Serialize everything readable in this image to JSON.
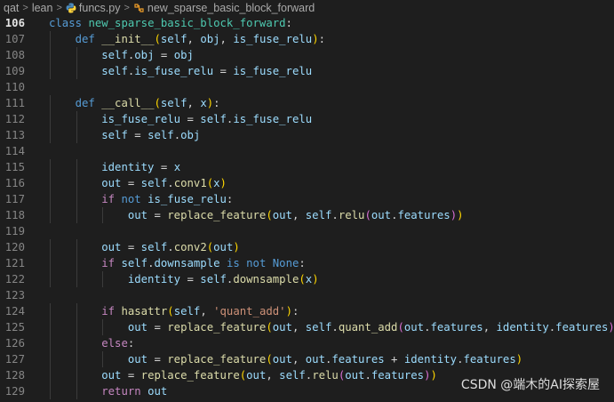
{
  "breadcrumb": {
    "items": [
      "qat",
      "lean",
      "funcs.py",
      "new_sparse_basic_block_forward"
    ],
    "separator": ">"
  },
  "editor": {
    "active_line": 106,
    "lines": [
      {
        "n": 106,
        "tokens": [
          {
            "t": "class",
            "c": "kw"
          },
          {
            "t": " "
          },
          {
            "t": "new_sparse_basic_block_forward",
            "c": "cls"
          },
          {
            "t": ":"
          }
        ]
      },
      {
        "n": 107,
        "tokens": [
          {
            "t": "    "
          },
          {
            "t": "def",
            "c": "kw"
          },
          {
            "t": " "
          },
          {
            "t": "__init__",
            "c": "fn"
          },
          {
            "t": "(",
            "c": "p1"
          },
          {
            "t": "self",
            "c": "self"
          },
          {
            "t": ", "
          },
          {
            "t": "obj",
            "c": "var"
          },
          {
            "t": ", "
          },
          {
            "t": "is_fuse_relu",
            "c": "var"
          },
          {
            "t": ")",
            "c": "p1"
          },
          {
            "t": ":"
          }
        ]
      },
      {
        "n": 108,
        "tokens": [
          {
            "t": "        "
          },
          {
            "t": "self",
            "c": "self"
          },
          {
            "t": "."
          },
          {
            "t": "obj",
            "c": "var"
          },
          {
            "t": " = "
          },
          {
            "t": "obj",
            "c": "var"
          }
        ]
      },
      {
        "n": 109,
        "tokens": [
          {
            "t": "        "
          },
          {
            "t": "self",
            "c": "self"
          },
          {
            "t": "."
          },
          {
            "t": "is_fuse_relu",
            "c": "var"
          },
          {
            "t": " = "
          },
          {
            "t": "is_fuse_relu",
            "c": "var"
          }
        ]
      },
      {
        "n": 110,
        "tokens": []
      },
      {
        "n": 111,
        "tokens": [
          {
            "t": "    "
          },
          {
            "t": "def",
            "c": "kw"
          },
          {
            "t": " "
          },
          {
            "t": "__call__",
            "c": "fn"
          },
          {
            "t": "(",
            "c": "p1"
          },
          {
            "t": "self",
            "c": "self"
          },
          {
            "t": ", "
          },
          {
            "t": "x",
            "c": "var"
          },
          {
            "t": ")",
            "c": "p1"
          },
          {
            "t": ":"
          }
        ]
      },
      {
        "n": 112,
        "tokens": [
          {
            "t": "        "
          },
          {
            "t": "is_fuse_relu",
            "c": "var"
          },
          {
            "t": " = "
          },
          {
            "t": "self",
            "c": "self"
          },
          {
            "t": "."
          },
          {
            "t": "is_fuse_relu",
            "c": "var"
          }
        ]
      },
      {
        "n": 113,
        "tokens": [
          {
            "t": "        "
          },
          {
            "t": "self",
            "c": "self"
          },
          {
            "t": " = "
          },
          {
            "t": "self",
            "c": "self"
          },
          {
            "t": "."
          },
          {
            "t": "obj",
            "c": "var"
          }
        ]
      },
      {
        "n": 114,
        "tokens": []
      },
      {
        "n": 115,
        "tokens": [
          {
            "t": "        "
          },
          {
            "t": "identity",
            "c": "var"
          },
          {
            "t": " = "
          },
          {
            "t": "x",
            "c": "var"
          }
        ]
      },
      {
        "n": 116,
        "tokens": [
          {
            "t": "        "
          },
          {
            "t": "out",
            "c": "var"
          },
          {
            "t": " = "
          },
          {
            "t": "self",
            "c": "self"
          },
          {
            "t": "."
          },
          {
            "t": "conv1",
            "c": "fn"
          },
          {
            "t": "(",
            "c": "p1"
          },
          {
            "t": "x",
            "c": "var"
          },
          {
            "t": ")",
            "c": "p1"
          }
        ]
      },
      {
        "n": 117,
        "tokens": [
          {
            "t": "        "
          },
          {
            "t": "if",
            "c": "kwc"
          },
          {
            "t": " "
          },
          {
            "t": "not",
            "c": "kw"
          },
          {
            "t": " "
          },
          {
            "t": "is_fuse_relu",
            "c": "var"
          },
          {
            "t": ":"
          }
        ]
      },
      {
        "n": 118,
        "tokens": [
          {
            "t": "            "
          },
          {
            "t": "out",
            "c": "var"
          },
          {
            "t": " = "
          },
          {
            "t": "replace_feature",
            "c": "fn"
          },
          {
            "t": "(",
            "c": "p1"
          },
          {
            "t": "out",
            "c": "var"
          },
          {
            "t": ", "
          },
          {
            "t": "self",
            "c": "self"
          },
          {
            "t": "."
          },
          {
            "t": "relu",
            "c": "fn"
          },
          {
            "t": "(",
            "c": "p2"
          },
          {
            "t": "out",
            "c": "var"
          },
          {
            "t": "."
          },
          {
            "t": "features",
            "c": "var"
          },
          {
            "t": ")",
            "c": "p2"
          },
          {
            "t": ")",
            "c": "p1"
          }
        ]
      },
      {
        "n": 119,
        "tokens": []
      },
      {
        "n": 120,
        "tokens": [
          {
            "t": "        "
          },
          {
            "t": "out",
            "c": "var"
          },
          {
            "t": " = "
          },
          {
            "t": "self",
            "c": "self"
          },
          {
            "t": "."
          },
          {
            "t": "conv2",
            "c": "fn"
          },
          {
            "t": "(",
            "c": "p1"
          },
          {
            "t": "out",
            "c": "var"
          },
          {
            "t": ")",
            "c": "p1"
          }
        ]
      },
      {
        "n": 121,
        "tokens": [
          {
            "t": "        "
          },
          {
            "t": "if",
            "c": "kwc"
          },
          {
            "t": " "
          },
          {
            "t": "self",
            "c": "self"
          },
          {
            "t": "."
          },
          {
            "t": "downsample",
            "c": "var"
          },
          {
            "t": " "
          },
          {
            "t": "is",
            "c": "kw"
          },
          {
            "t": " "
          },
          {
            "t": "not",
            "c": "kw"
          },
          {
            "t": " "
          },
          {
            "t": "None",
            "c": "kw"
          },
          {
            "t": ":"
          }
        ]
      },
      {
        "n": 122,
        "tokens": [
          {
            "t": "            "
          },
          {
            "t": "identity",
            "c": "var"
          },
          {
            "t": " = "
          },
          {
            "t": "self",
            "c": "self"
          },
          {
            "t": "."
          },
          {
            "t": "downsample",
            "c": "fn"
          },
          {
            "t": "(",
            "c": "p1"
          },
          {
            "t": "x",
            "c": "var"
          },
          {
            "t": ")",
            "c": "p1"
          }
        ]
      },
      {
        "n": 123,
        "tokens": []
      },
      {
        "n": 124,
        "tokens": [
          {
            "t": "        "
          },
          {
            "t": "if",
            "c": "kwc"
          },
          {
            "t": " "
          },
          {
            "t": "hasattr",
            "c": "fn"
          },
          {
            "t": "(",
            "c": "p1"
          },
          {
            "t": "self",
            "c": "self"
          },
          {
            "t": ", "
          },
          {
            "t": "'quant_add'",
            "c": "str"
          },
          {
            "t": ")",
            "c": "p1"
          },
          {
            "t": ":"
          }
        ]
      },
      {
        "n": 125,
        "tokens": [
          {
            "t": "            "
          },
          {
            "t": "out",
            "c": "var"
          },
          {
            "t": " = "
          },
          {
            "t": "replace_feature",
            "c": "fn"
          },
          {
            "t": "(",
            "c": "p1"
          },
          {
            "t": "out",
            "c": "var"
          },
          {
            "t": ", "
          },
          {
            "t": "self",
            "c": "self"
          },
          {
            "t": "."
          },
          {
            "t": "quant_add",
            "c": "fn"
          },
          {
            "t": "(",
            "c": "p2"
          },
          {
            "t": "out",
            "c": "var"
          },
          {
            "t": "."
          },
          {
            "t": "features",
            "c": "var"
          },
          {
            "t": ", "
          },
          {
            "t": "identity",
            "c": "var"
          },
          {
            "t": "."
          },
          {
            "t": "features",
            "c": "var"
          },
          {
            "t": ")",
            "c": "p2"
          },
          {
            "t": ")",
            "c": "p1"
          }
        ]
      },
      {
        "n": 126,
        "tokens": [
          {
            "t": "        "
          },
          {
            "t": "else",
            "c": "kwc"
          },
          {
            "t": ":"
          }
        ]
      },
      {
        "n": 127,
        "tokens": [
          {
            "t": "            "
          },
          {
            "t": "out",
            "c": "var"
          },
          {
            "t": " = "
          },
          {
            "t": "replace_feature",
            "c": "fn"
          },
          {
            "t": "(",
            "c": "p1"
          },
          {
            "t": "out",
            "c": "var"
          },
          {
            "t": ", "
          },
          {
            "t": "out",
            "c": "var"
          },
          {
            "t": "."
          },
          {
            "t": "features",
            "c": "var"
          },
          {
            "t": " + "
          },
          {
            "t": "identity",
            "c": "var"
          },
          {
            "t": "."
          },
          {
            "t": "features",
            "c": "var"
          },
          {
            "t": ")",
            "c": "p1"
          }
        ]
      },
      {
        "n": 128,
        "tokens": [
          {
            "t": "        "
          },
          {
            "t": "out",
            "c": "var"
          },
          {
            "t": " = "
          },
          {
            "t": "replace_feature",
            "c": "fn"
          },
          {
            "t": "(",
            "c": "p1"
          },
          {
            "t": "out",
            "c": "var"
          },
          {
            "t": ", "
          },
          {
            "t": "self",
            "c": "self"
          },
          {
            "t": "."
          },
          {
            "t": "relu",
            "c": "fn"
          },
          {
            "t": "(",
            "c": "p2"
          },
          {
            "t": "out",
            "c": "var"
          },
          {
            "t": "."
          },
          {
            "t": "features",
            "c": "var"
          },
          {
            "t": ")",
            "c": "p2"
          },
          {
            "t": ")",
            "c": "p1"
          }
        ]
      },
      {
        "n": 129,
        "tokens": [
          {
            "t": "        "
          },
          {
            "t": "return",
            "c": "kwc"
          },
          {
            "t": " "
          },
          {
            "t": "out",
            "c": "var"
          }
        ]
      }
    ]
  },
  "watermark": "CSDN @端木的AI探索屋",
  "colors": {
    "background": "#1e1e1e",
    "keyword": "#569cd6",
    "control_keyword": "#c586c0",
    "class_name": "#4ec9b0",
    "function": "#dcdcaa",
    "variable": "#9cdcfe",
    "string": "#ce9178"
  }
}
